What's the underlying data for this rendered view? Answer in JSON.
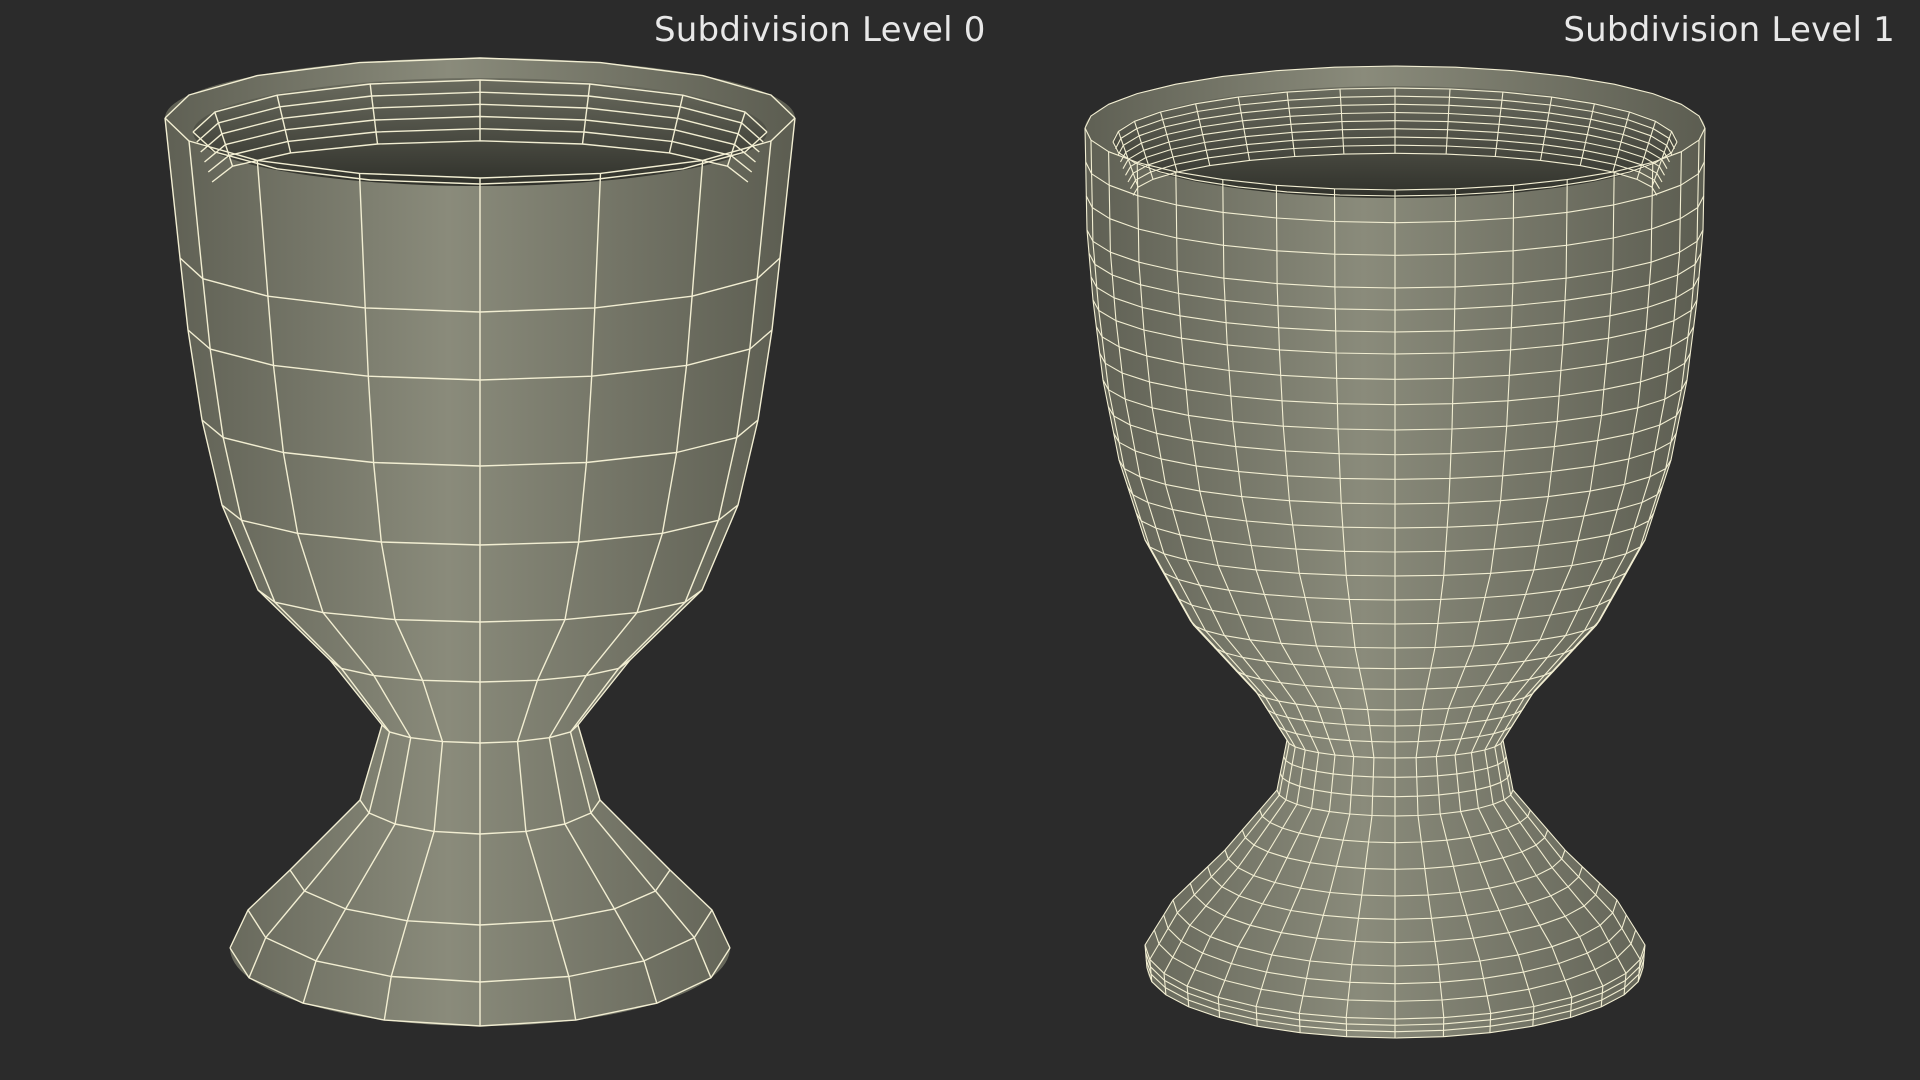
{
  "viewports": {
    "left": {
      "label": "Subdivision Level 0",
      "radial_segments": 16,
      "wire_color": "#f2eed2",
      "surface_color": "#7e7f70"
    },
    "right": {
      "label": "Subdivision Level 1",
      "radial_segments": 32,
      "wire_color": "#f2eed2",
      "surface_color": "#7e7f70"
    }
  },
  "background_color": "#2b2b2b"
}
